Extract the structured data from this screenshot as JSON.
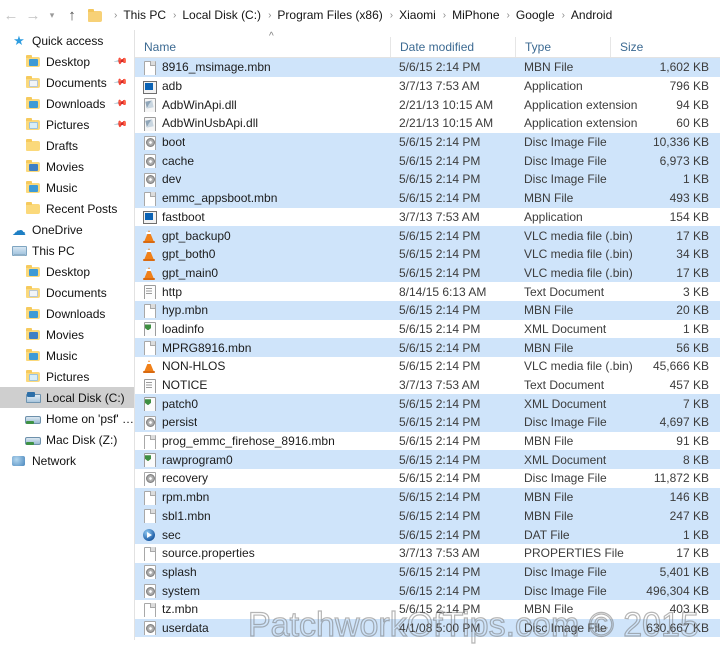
{
  "nav": {
    "back_icon": "arrow-left-icon",
    "forward_icon": "arrow-right-icon",
    "history_icon": "chevron-down-icon",
    "up_icon": "arrow-up-icon",
    "folder_icon": "folder-icon",
    "separator": "›",
    "breadcrumbs": [
      "This PC",
      "Local Disk (C:)",
      "Program Files (x86)",
      "Xiaomi",
      "MiPhone",
      "Google",
      "Android"
    ]
  },
  "sidebar": {
    "groups": [
      {
        "header": {
          "label": "Quick access",
          "icon": "star-icon"
        },
        "items": [
          {
            "label": "Desktop",
            "icon": "folder-desktop-icon",
            "pinned": true,
            "pin_icon": "pin-icon"
          },
          {
            "label": "Documents",
            "icon": "folder-documents-icon",
            "pinned": true,
            "pin_icon": "pin-icon"
          },
          {
            "label": "Downloads",
            "icon": "folder-downloads-icon",
            "pinned": true,
            "pin_icon": "pin-icon"
          },
          {
            "label": "Pictures",
            "icon": "folder-pictures-icon",
            "pinned": true,
            "pin_icon": "pin-icon"
          },
          {
            "label": "Drafts",
            "icon": "folder-icon",
            "pinned": false
          },
          {
            "label": "Movies",
            "icon": "folder-movies-icon",
            "pinned": false
          },
          {
            "label": "Music",
            "icon": "folder-music-icon",
            "pinned": false
          },
          {
            "label": "Recent Posts",
            "icon": "folder-icon",
            "pinned": false
          }
        ]
      },
      {
        "header": {
          "label": "OneDrive",
          "icon": "cloud-icon"
        },
        "items": []
      },
      {
        "header": {
          "label": "This PC",
          "icon": "computer-icon"
        },
        "items": [
          {
            "label": "Desktop",
            "icon": "folder-desktop-icon",
            "pinned": false
          },
          {
            "label": "Documents",
            "icon": "folder-documents-icon",
            "pinned": false
          },
          {
            "label": "Downloads",
            "icon": "folder-downloads-icon",
            "pinned": false
          },
          {
            "label": "Movies",
            "icon": "folder-movies-icon",
            "pinned": false
          },
          {
            "label": "Music",
            "icon": "folder-music-icon",
            "pinned": false
          },
          {
            "label": "Pictures",
            "icon": "folder-pictures-icon",
            "pinned": false
          },
          {
            "label": "Local Disk (C:)",
            "icon": "hard-drive-icon",
            "pinned": false,
            "selected": true
          },
          {
            "label": "Home on 'psf' (Y:)",
            "icon": "network-drive-icon",
            "pinned": false
          },
          {
            "label": "Mac Disk (Z:)",
            "icon": "network-drive-icon",
            "pinned": false
          }
        ]
      },
      {
        "header": {
          "label": "Network",
          "icon": "network-icon"
        },
        "items": []
      }
    ]
  },
  "file_list": {
    "columns": [
      {
        "label": "Name",
        "sorted": true,
        "sort_icon": "caret-up-icon"
      },
      {
        "label": "Date modified"
      },
      {
        "label": "Type"
      },
      {
        "label": "Size"
      }
    ],
    "rows": [
      {
        "name": "8916_msimage.mbn",
        "date": "5/6/15 2:14 PM",
        "type": "MBN File",
        "size": "1,602 KB",
        "icon": "blank-file-icon",
        "highlight": true
      },
      {
        "name": "adb",
        "date": "3/7/13 7:53 AM",
        "type": "Application",
        "size": "796 KB",
        "icon": "application-icon",
        "highlight": false
      },
      {
        "name": "AdbWinApi.dll",
        "date": "2/21/13 10:15 AM",
        "type": "Application extension",
        "size": "94 KB",
        "icon": "dll-file-icon",
        "highlight": false
      },
      {
        "name": "AdbWinUsbApi.dll",
        "date": "2/21/13 10:15 AM",
        "type": "Application extension",
        "size": "60 KB",
        "icon": "dll-file-icon",
        "highlight": false
      },
      {
        "name": "boot",
        "date": "5/6/15 2:14 PM",
        "type": "Disc Image File",
        "size": "10,336 KB",
        "icon": "disc-image-icon",
        "highlight": true
      },
      {
        "name": "cache",
        "date": "5/6/15 2:14 PM",
        "type": "Disc Image File",
        "size": "6,973 KB",
        "icon": "disc-image-icon",
        "highlight": true
      },
      {
        "name": "dev",
        "date": "5/6/15 2:14 PM",
        "type": "Disc Image File",
        "size": "1 KB",
        "icon": "disc-image-icon",
        "highlight": true
      },
      {
        "name": "emmc_appsboot.mbn",
        "date": "5/6/15 2:14 PM",
        "type": "MBN File",
        "size": "493 KB",
        "icon": "blank-file-icon",
        "highlight": true
      },
      {
        "name": "fastboot",
        "date": "3/7/13 7:53 AM",
        "type": "Application",
        "size": "154 KB",
        "icon": "application-icon",
        "highlight": false
      },
      {
        "name": "gpt_backup0",
        "date": "5/6/15 2:14 PM",
        "type": "VLC media file (.bin)",
        "size": "17 KB",
        "icon": "vlc-media-icon",
        "highlight": true
      },
      {
        "name": "gpt_both0",
        "date": "5/6/15 2:14 PM",
        "type": "VLC media file (.bin)",
        "size": "34 KB",
        "icon": "vlc-media-icon",
        "highlight": true
      },
      {
        "name": "gpt_main0",
        "date": "5/6/15 2:14 PM",
        "type": "VLC media file (.bin)",
        "size": "17 KB",
        "icon": "vlc-media-icon",
        "highlight": true
      },
      {
        "name": "http",
        "date": "8/14/15 6:13 AM",
        "type": "Text Document",
        "size": "3 KB",
        "icon": "text-document-icon",
        "highlight": false
      },
      {
        "name": "hyp.mbn",
        "date": "5/6/15 2:14 PM",
        "type": "MBN File",
        "size": "20 KB",
        "icon": "blank-file-icon",
        "highlight": true
      },
      {
        "name": "loadinfo",
        "date": "5/6/15 2:14 PM",
        "type": "XML Document",
        "size": "1 KB",
        "icon": "xml-document-icon",
        "highlight": false
      },
      {
        "name": "MPRG8916.mbn",
        "date": "5/6/15 2:14 PM",
        "type": "MBN File",
        "size": "56 KB",
        "icon": "blank-file-icon",
        "highlight": true
      },
      {
        "name": "NON-HLOS",
        "date": "5/6/15 2:14 PM",
        "type": "VLC media file (.bin)",
        "size": "45,666 KB",
        "icon": "vlc-media-icon",
        "highlight": false
      },
      {
        "name": "NOTICE",
        "date": "3/7/13 7:53 AM",
        "type": "Text Document",
        "size": "457 KB",
        "icon": "text-document-icon",
        "highlight": false
      },
      {
        "name": "patch0",
        "date": "5/6/15 2:14 PM",
        "type": "XML Document",
        "size": "7 KB",
        "icon": "xml-document-icon",
        "highlight": true
      },
      {
        "name": "persist",
        "date": "5/6/15 2:14 PM",
        "type": "Disc Image File",
        "size": "4,697 KB",
        "icon": "disc-image-icon",
        "highlight": true
      },
      {
        "name": "prog_emmc_firehose_8916.mbn",
        "date": "5/6/15 2:14 PM",
        "type": "MBN File",
        "size": "91 KB",
        "icon": "blank-file-icon",
        "highlight": false
      },
      {
        "name": "rawprogram0",
        "date": "5/6/15 2:14 PM",
        "type": "XML Document",
        "size": "8 KB",
        "icon": "xml-document-icon",
        "highlight": true
      },
      {
        "name": "recovery",
        "date": "5/6/15 2:14 PM",
        "type": "Disc Image File",
        "size": "11,872 KB",
        "icon": "disc-image-icon",
        "highlight": false
      },
      {
        "name": "rpm.mbn",
        "date": "5/6/15 2:14 PM",
        "type": "MBN File",
        "size": "146 KB",
        "icon": "blank-file-icon",
        "highlight": true
      },
      {
        "name": "sbl1.mbn",
        "date": "5/6/15 2:14 PM",
        "type": "MBN File",
        "size": "247 KB",
        "icon": "blank-file-icon",
        "highlight": true
      },
      {
        "name": "sec",
        "date": "5/6/15 2:14 PM",
        "type": "DAT File",
        "size": "1 KB",
        "icon": "dat-media-icon",
        "highlight": true
      },
      {
        "name": "source.properties",
        "date": "3/7/13 7:53 AM",
        "type": "PROPERTIES File",
        "size": "17 KB",
        "icon": "blank-file-icon",
        "highlight": false
      },
      {
        "name": "splash",
        "date": "5/6/15 2:14 PM",
        "type": "Disc Image File",
        "size": "5,401 KB",
        "icon": "disc-image-icon",
        "highlight": true
      },
      {
        "name": "system",
        "date": "5/6/15 2:14 PM",
        "type": "Disc Image File",
        "size": "496,304 KB",
        "icon": "disc-image-icon",
        "highlight": true
      },
      {
        "name": "tz.mbn",
        "date": "5/6/15 2:14 PM",
        "type": "MBN File",
        "size": "403 KB",
        "icon": "blank-file-icon",
        "highlight": false
      },
      {
        "name": "userdata",
        "date": "4/1/08 5:00 PM",
        "type": "Disc Image File",
        "size": "630,667 KB",
        "icon": "disc-image-icon",
        "highlight": true
      }
    ]
  },
  "watermark": {
    "text": "PatchworkOfTips.com © 2015"
  },
  "colors": {
    "row_highlight": "#cfe4fa",
    "header_text": "#3c6a92",
    "sidebar_selected": "#cfcfcf",
    "accent_blue": "#0a62b4"
  }
}
